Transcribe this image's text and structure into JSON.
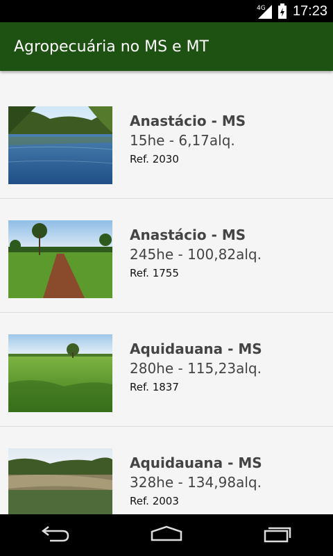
{
  "status_bar": {
    "network": "4G",
    "time": "17:23"
  },
  "app_bar": {
    "title": "Agropecuária no MS e MT",
    "color": "#1d5212"
  },
  "listings": [
    {
      "title": "Anastácio - MS",
      "area": "15he - 6,17alq.",
      "ref": "Ref. 2030",
      "thumb": "river-lake"
    },
    {
      "title": "Anastácio - MS",
      "area": "245he - 100,82alq.",
      "ref": "Ref. 1755",
      "thumb": "dirt-road-pasture"
    },
    {
      "title": "Aquidauana - MS",
      "area": "280he - 115,23alq.",
      "ref": "Ref. 1837",
      "thumb": "grass-field"
    },
    {
      "title": "Aquidauana - MS",
      "area": "328he - 134,98alq.",
      "ref": "Ref. 2003",
      "thumb": "river-bank"
    }
  ],
  "nav": {
    "back": "back-icon",
    "home": "home-icon",
    "recents": "recents-icon"
  }
}
